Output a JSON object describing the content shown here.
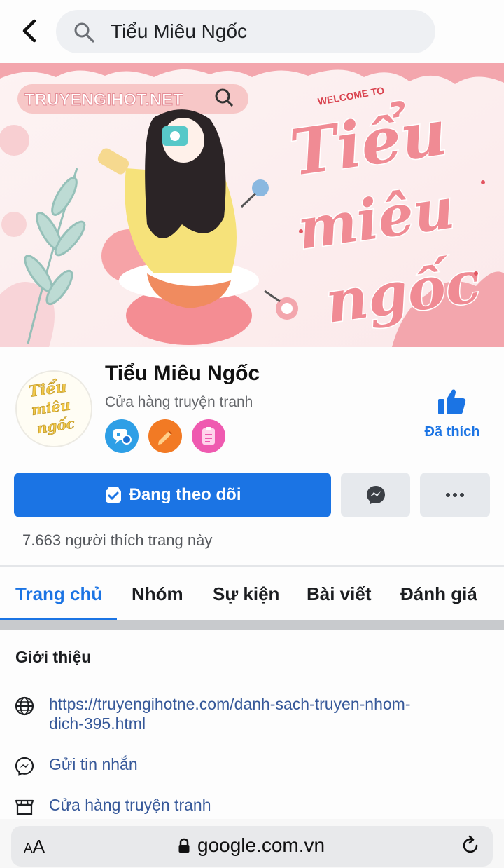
{
  "search": {
    "query": "Tiểu Miêu Ngốc"
  },
  "cover": {
    "site_label": "TRUYENGIHOT.NET",
    "welcome": "WELCOME TO",
    "lettering": [
      "Tiểu",
      "miêu",
      "ngốc"
    ]
  },
  "profile": {
    "name": "Tiểu Miêu Ngốc",
    "category": "Cửa hàng truyện tranh",
    "liked_label": "Đã thích"
  },
  "actions": {
    "follow_label": "Đang theo dõi",
    "likes_text": "7.663 người thích trang này"
  },
  "tabs": [
    {
      "label": "Trang chủ",
      "active": true
    },
    {
      "label": "Nhóm"
    },
    {
      "label": "Sự kiện"
    },
    {
      "label": "Bài viết"
    },
    {
      "label": "Đánh giá"
    }
  ],
  "intro": {
    "title": "Giới thiệu",
    "website_line1": "https://truyengihotne.com/danh-sach-truyen-nhom-",
    "website_line2": "dich-395.html",
    "message": "Gửi tin nhắn",
    "category": "Cửa hàng truyện tranh"
  },
  "browser": {
    "text_size_label_small": "A",
    "text_size_label_large": "A",
    "url": "google.com.vn"
  },
  "colors": {
    "accent": "#1b74e4",
    "link": "#365899",
    "cover_pink": "#f08b94"
  }
}
